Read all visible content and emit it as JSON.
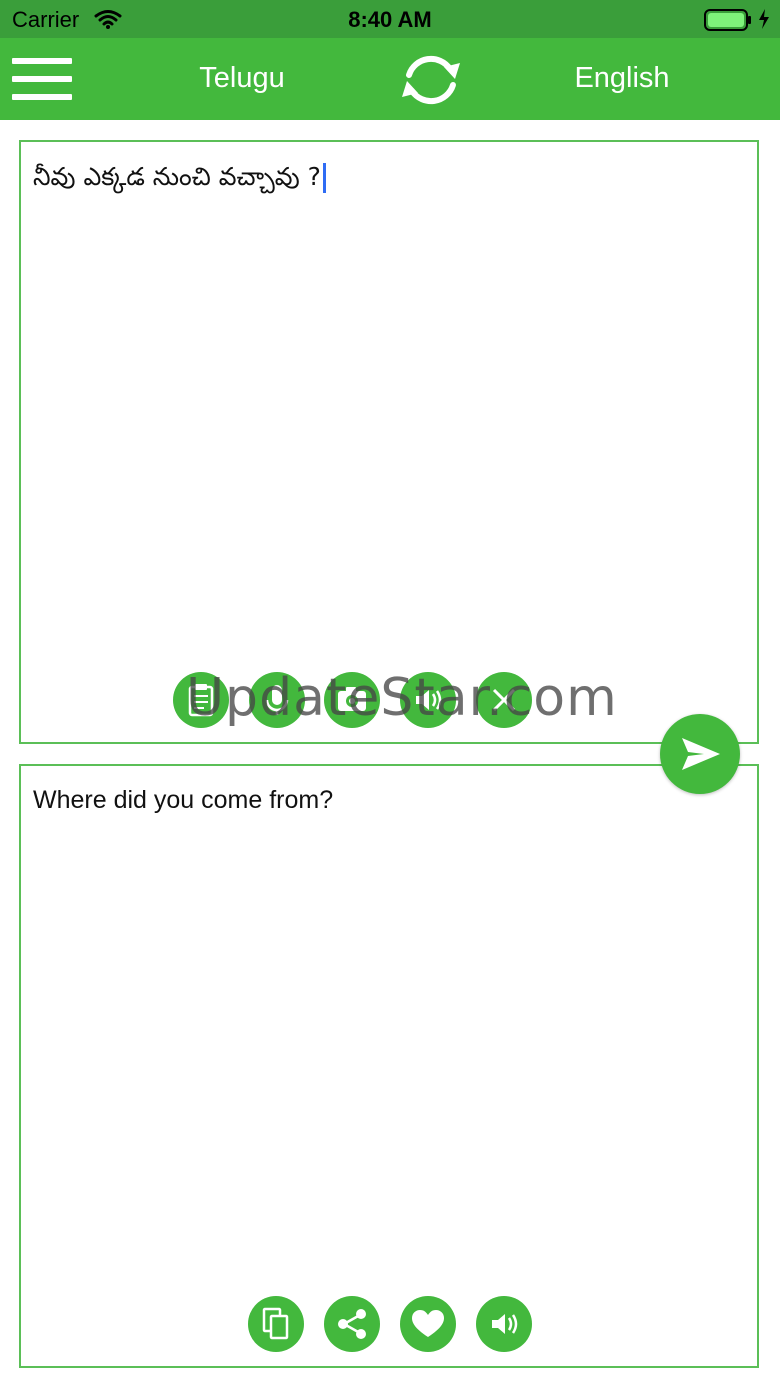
{
  "status": {
    "carrier": "Carrier",
    "time": "8:40 AM"
  },
  "nav": {
    "source_language": "Telugu",
    "target_language": "English",
    "icons": [
      "menu-icon",
      "swap-languages-icon"
    ]
  },
  "source_panel": {
    "input_text": "నీవు ఎక్కడ నుంచి వచ్చావు ?",
    "actions": [
      "paste-icon",
      "microphone-icon",
      "camera-icon",
      "speaker-icon",
      "clear-icon"
    ]
  },
  "target_panel": {
    "output_text": "Where did you come from?",
    "actions": [
      "copy-icon",
      "share-icon",
      "favorite-icon",
      "speaker-icon"
    ]
  },
  "send": {
    "icon": "send-icon"
  },
  "watermark": {
    "text": "UpdateStar.com"
  },
  "colors": {
    "status_bar": "#3a9e3a",
    "nav_bar": "#43b83d",
    "accent": "#43b83d",
    "panel_border": "#5bbf57",
    "caret": "#2f6cf4"
  }
}
